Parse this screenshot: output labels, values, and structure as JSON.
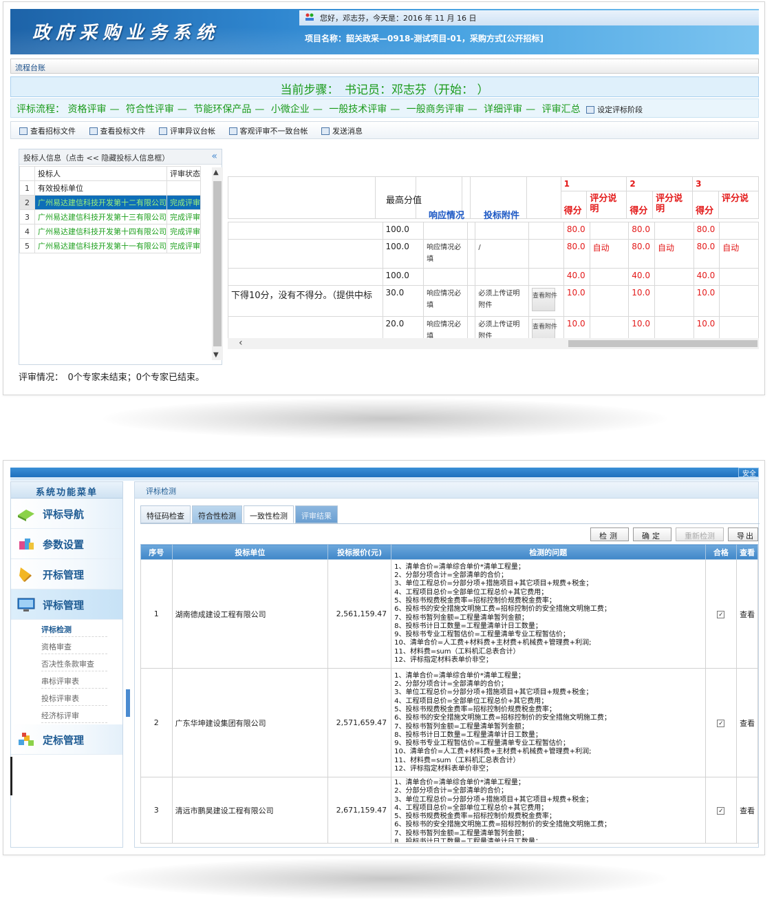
{
  "panel1": {
    "system_title": "政府采购业务系统",
    "greeting": "您好，邓志芬，今天是：2016 年 11 月 16 日",
    "project": "项目名称：韶关政采—0918-测试项目-01，采购方式[公开招标]",
    "tab": "流程台账",
    "current_step": "当前步骤：　书记员：邓志芬（开始：  ）",
    "flow_label": "评标流程：",
    "flow_steps": [
      "资格评审",
      "符合性评审",
      "节能环保产品",
      "小微企业",
      "一般技术评审",
      "一般商务评审",
      "详细评审",
      "评审汇总"
    ],
    "flow_sep": "—",
    "set_phase": "设定评标阶段",
    "toolbar": [
      "查看招标文件",
      "查看投标文件",
      "评审异议台帐",
      "客观评审不一致台帐",
      "发送消息"
    ],
    "bidder_panel_title": "投标人信息（点击 << 隐藏投标人信息框）",
    "collapse_glyph": "«",
    "bidder_headers": [
      "投标人",
      "评审状态"
    ],
    "bidders": [
      {
        "n": "1",
        "name": "有效投标单位",
        "status": ""
      },
      {
        "n": "2",
        "name": "广州易达建信科技开发第十二有限公司",
        "status": "完成评审"
      },
      {
        "n": "3",
        "name": "广州易达建信科技开发第十三有限公司",
        "status": "完成评审"
      },
      {
        "n": "4",
        "name": "广州易达建信科技开发第十四有限公司",
        "status": "完成评审"
      },
      {
        "n": "5",
        "name": "广州易达建信科技开发第十一有限公司",
        "status": "完成评审"
      }
    ],
    "score_head": {
      "max_score": "最高分值",
      "response": "响应情况",
      "attachment": "投标附件",
      "col_score": "得分",
      "col_note": "评分说明",
      "col_note_cut": "评分说",
      "supplier_nums": [
        "1",
        "2",
        "3"
      ]
    },
    "rows": [
      {
        "desc": "",
        "max": "100.0",
        "resp": "",
        "att": "",
        "btn": "",
        "s": [
          "80.0",
          "80.0",
          "80.0"
        ],
        "n": [
          "",
          "",
          ""
        ]
      },
      {
        "desc": "",
        "max": "100.0",
        "resp": "响应情况必填",
        "att": "/",
        "btn": "",
        "s": [
          "80.0",
          "80.0",
          "80.0"
        ],
        "n": [
          "自动",
          "自动",
          "自动"
        ]
      },
      {
        "desc": "",
        "max": "100.0",
        "resp": "",
        "att": "",
        "btn": "",
        "s": [
          "40.0",
          "40.0",
          "40.0"
        ],
        "n": [
          "",
          "",
          ""
        ]
      },
      {
        "desc": "下得10分，没有不得分。（提供中标",
        "max": "30.0",
        "resp": "响应情况必填",
        "att": "必须上传证明附件",
        "btn": "查看附件",
        "s": [
          "10.0",
          "10.0",
          "10.0"
        ],
        "n": [
          "",
          "",
          ""
        ]
      },
      {
        "desc": "",
        "max": "20.0",
        "resp": "响应情况必填",
        "att": "必须上传证明附件",
        "btn": "查看附件",
        "s": [
          "10.0",
          "10.0",
          "10.0"
        ],
        "n": [
          "",
          "",
          ""
        ]
      }
    ],
    "status_line": "评审情况：　0个专家未结束；0个专家已结束。"
  },
  "panel2": {
    "safe_text": "安全",
    "menu_title": "系统功能菜单",
    "menu": [
      "评标导航",
      "参数设置",
      "开标管理",
      "评标管理",
      "定标管理"
    ],
    "submenu": [
      "评标检测",
      "资格审查",
      "否决性条款审查",
      "串标评审表",
      "投标评审表",
      "经济标评审"
    ],
    "breadcrumb": "评标检测",
    "tabs": [
      "特征码检查",
      "符合性检测",
      "一致性检测",
      "评审结果"
    ],
    "buttons": [
      "检测",
      "确定",
      "重新检测",
      "导出"
    ],
    "headers": [
      "序号",
      "投标单位",
      "投标报价(元)",
      "检测的问题",
      "合格",
      "查看"
    ],
    "issues_full": [
      "1、清单合价=清单综合单价*清单工程量；",
      "2、分部分项合计=全部清单的合价；",
      "3、单位工程总价=分部分项+措施项目+其它项目+规费+税金；",
      "4、工程项目总价=全部单位工程总价+其它费用；",
      "5、投标书规费税金费率=招标控制价规费税金费率；",
      "6、投标书的安全措施文明施工费=招标控制价的安全措施文明施工费；",
      "7、投标书暂列金额=工程量清单暂列金额；",
      "8、投标书计日工数量=工程量清单计日工数量；",
      "9、投标书专业工程暂估价=工程量清单专业工程暂估价；",
      "10、清单合价=人工费+材料费+主材费+机械费+管理费+利润;",
      "11、材料费=sum（工料机汇总表合计）",
      "12、评标指定材料表单价非空；"
    ],
    "rows": [
      {
        "n": "1",
        "name": "湖南德成建设工程有限公司",
        "price": "2,561,159.47",
        "ok": "✓",
        "view": "查看"
      },
      {
        "n": "2",
        "name": "广东华坤建设集团有限公司",
        "price": "2,571,659.47",
        "ok": "✓",
        "view": "查看"
      },
      {
        "n": "3",
        "name": "清远市鹏昊建设工程有限公司",
        "price": "2,671,159.47",
        "ok": "✓",
        "view": "查看"
      }
    ]
  }
}
